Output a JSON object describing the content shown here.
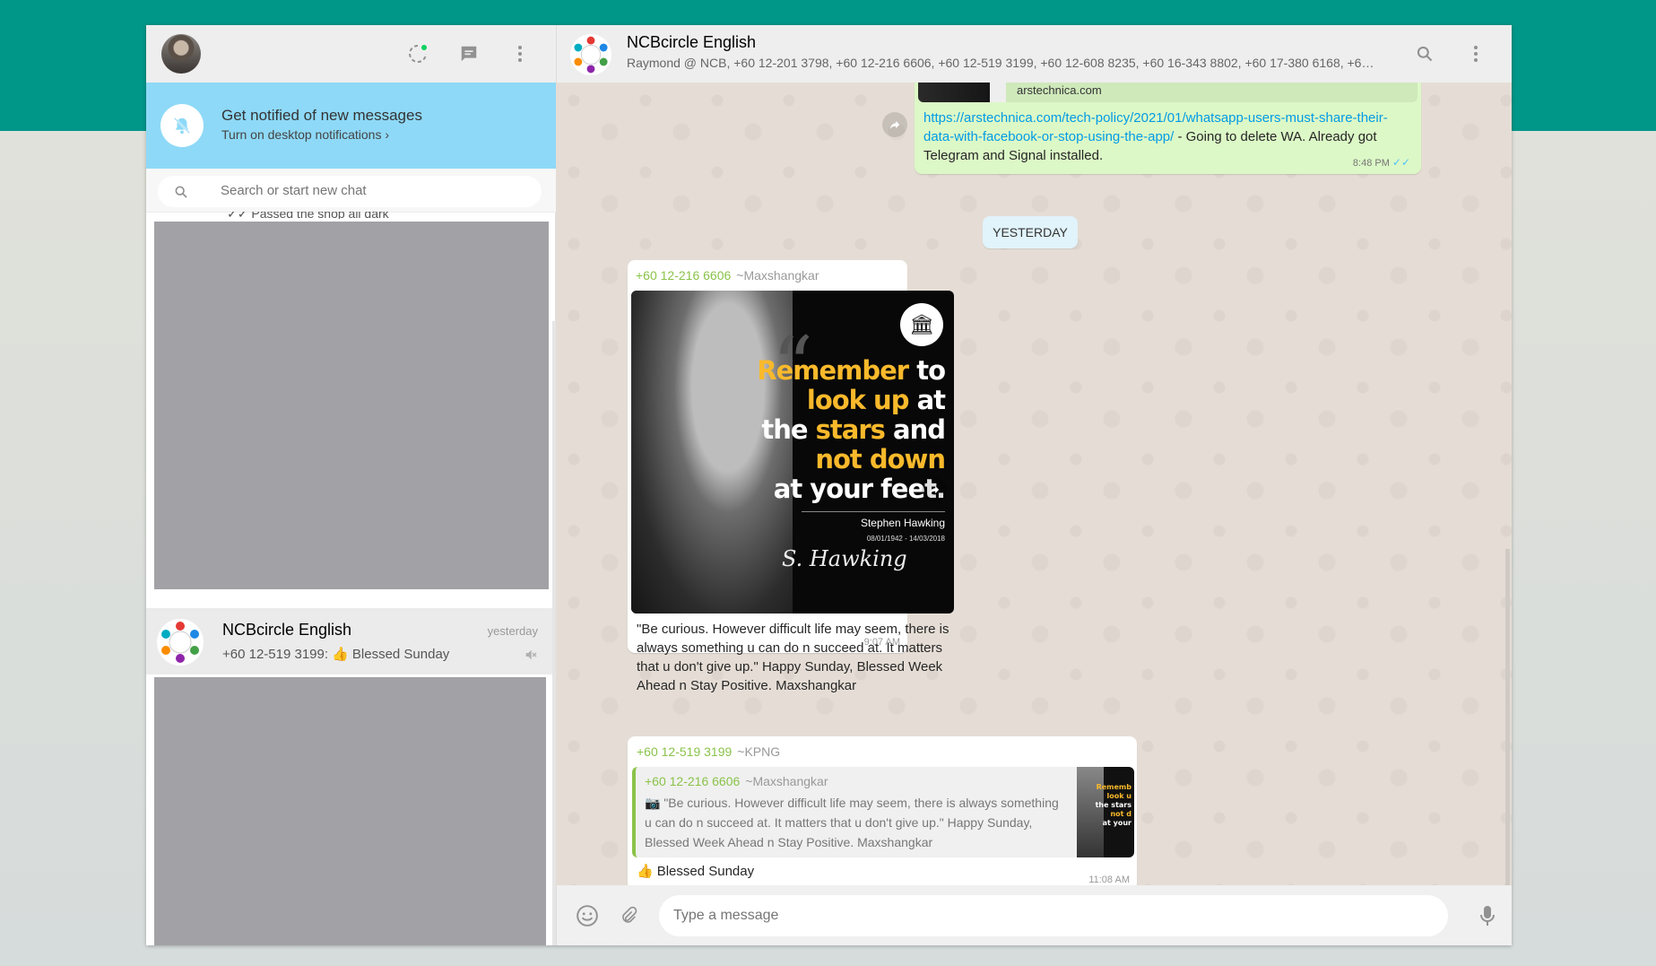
{
  "sidebar": {
    "notification": {
      "title": "Get notified of new messages",
      "subtitle": "Turn on desktop notifications ›"
    },
    "search": {
      "placeholder": "Search or start new chat"
    },
    "peek_preview": "✓✓ Passed the shop all dark",
    "chat_list": [
      {
        "name": "NCBcircle English",
        "time": "yesterday",
        "sender": "+60 12-519 3199:",
        "last_message": "Blessed Sunday",
        "muted": true
      }
    ]
  },
  "conversation": {
    "title": "NCBcircle English",
    "members": "Raymond @ NCB, +60 12-201 3798, +60 12-216 6606, +60 12-519 3199, +60 12-608 8235, +60 16-343 8802, +60 17-380 6168, +6…",
    "messages": {
      "outgoing": {
        "link_domain": "arstechnica.com",
        "link": "https://arstechnica.com/tech-policy/2021/01/whatsapp-users-must-share-their-data-with-facebook-or-stop-using-the-app/",
        "text": " - Going to delete WA. Already got Telegram and Signal installed.",
        "time": "8:48 PM",
        "status": "read"
      },
      "date_divider": "YESTERDAY",
      "image_message": {
        "sender_number": "+60 12-216 6606",
        "sender_alias": "~Maxshangkar",
        "image": {
          "quote_lines": [
            [
              {
                "text": "Remember ",
                "color": "yellow"
              },
              {
                "text": "to",
                "color": "white"
              }
            ],
            [
              {
                "text": "look up ",
                "color": "yellow"
              },
              {
                "text": "at",
                "color": "white"
              }
            ],
            [
              {
                "text": "the ",
                "color": "white"
              },
              {
                "text": "stars ",
                "color": "yellow"
              },
              {
                "text": "and",
                "color": "white"
              }
            ],
            [
              {
                "text": "not down",
                "color": "yellow"
              }
            ],
            [
              {
                "text": "at your feet.",
                "color": "white"
              }
            ]
          ],
          "author": "Stephen Hawking",
          "dates": "08/01/1942 - 14/03/2018",
          "signature": "S. Hawking"
        },
        "caption": "\"Be curious. However difficult life may seem, there is always something u can do n succeed at. It matters that u don't give up.\" Happy Sunday, Blessed Week Ahead n Stay Positive. Maxshangkar",
        "time": "9:07 AM"
      },
      "reply_message": {
        "sender_number": "+60 12-519 3199",
        "sender_alias": "~KPNG",
        "quoted": {
          "sender_number": "+60 12-216 6606",
          "sender_alias": "~Maxshangkar",
          "text": "\"Be curious. However difficult life may seem, there is always something u can do n succeed at. It matters that u don't give up.\" Happy Sunday, Blessed Week Ahead n Stay Positive. Maxshangkar",
          "thumb_lines": [
            "Rememb",
            "look u",
            "the stars",
            "not d",
            "at your"
          ]
        },
        "text": "Blessed Sunday",
        "time": "11:08 AM"
      }
    },
    "composer": {
      "placeholder": "Type a message"
    }
  },
  "colors": {
    "accent": "#009688",
    "outgoing_bubble": "#dcf8c6",
    "link": "#039be5",
    "sender_number": "#8bc34a",
    "notification_banner": "#8ed9f7",
    "quote_yellow": "#f9b92b"
  },
  "icons": [
    "status-icon",
    "new-chat-icon",
    "menu-icon",
    "bell-off-icon",
    "search-icon",
    "mute-icon",
    "forward-icon",
    "camera-icon",
    "emoji-icon",
    "attach-icon",
    "mic-icon"
  ]
}
